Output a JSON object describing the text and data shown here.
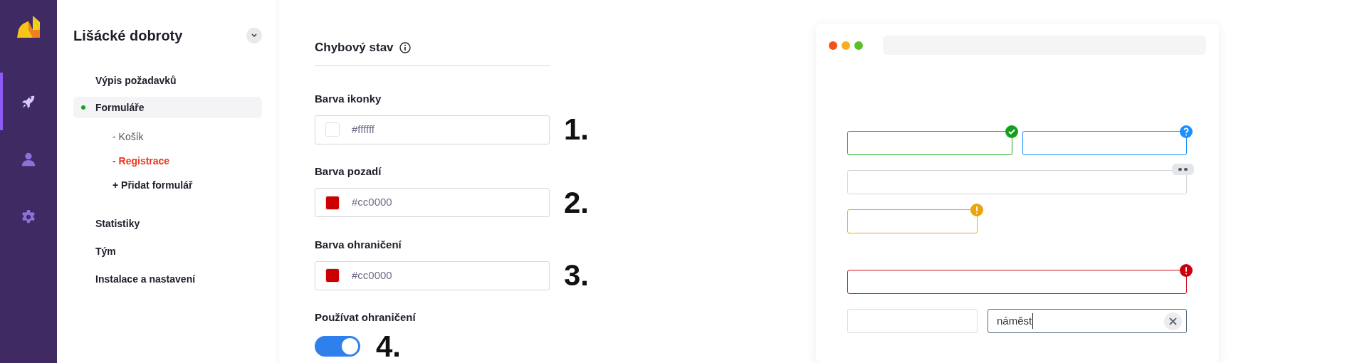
{
  "app_rail": {
    "items": [
      {
        "kind": "rocket",
        "selected": true
      },
      {
        "kind": "person",
        "selected": false
      },
      {
        "kind": "gear",
        "selected": false
      }
    ]
  },
  "sidebar": {
    "title": "Lišácké dobroty",
    "items": [
      {
        "label": "Výpis požadavků",
        "selected": false
      },
      {
        "label": "Formuláře",
        "selected": true,
        "children": [
          {
            "label": "- Košík",
            "kind": "form",
            "selected": false
          },
          {
            "label": "- Registrace",
            "kind": "form",
            "selected": true
          },
          {
            "label": "+ Přidat formulář",
            "kind": "add"
          }
        ]
      },
      {
        "label": "Statistiky",
        "selected": false
      },
      {
        "label": "Tým",
        "selected": false
      },
      {
        "label": "Instalace a nastavení",
        "selected": false
      }
    ]
  },
  "form": {
    "section_title": "Chybový stav",
    "fields": [
      {
        "label": "Barva ikonky",
        "value": "#ffffff",
        "color": "#ffffff",
        "step": "1."
      },
      {
        "label": "Barva pozadí",
        "value": "#cc0000",
        "color": "#cc0000",
        "step": "2."
      },
      {
        "label": "Barva ohraničení",
        "value": "#cc0000",
        "color": "#cc0000",
        "step": "3."
      }
    ],
    "toggle": {
      "label": "Používat ohraničení",
      "on": true,
      "step": "4."
    }
  },
  "preview": {
    "rows": [
      {
        "fields": [
          {
            "kind": "success"
          },
          {
            "kind": "info"
          }
        ]
      },
      {
        "fields": [
          {
            "kind": "default"
          }
        ]
      },
      {
        "fields": [
          {
            "kind": "warning"
          }
        ]
      },
      {
        "fields": [
          {
            "kind": "error"
          }
        ]
      },
      {
        "fields": [
          {
            "kind": "plain"
          },
          {
            "kind": "active",
            "value": "náměst"
          }
        ]
      }
    ]
  }
}
